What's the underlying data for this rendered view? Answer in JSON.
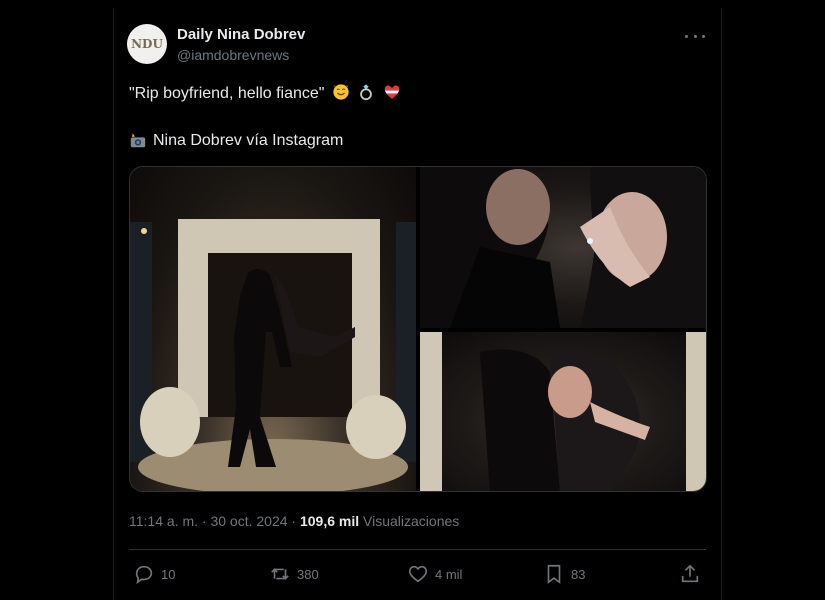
{
  "author": {
    "display_name": "Daily Nina Dobrev",
    "handle": "@iamdobrevnews",
    "avatar_text": "NDU"
  },
  "tweet": {
    "text": "\"Rip boyfriend, hello fiance\"",
    "line2": "Nina Dobrev vía Instagram"
  },
  "media": {
    "photos": [
      "engagement-arch-photo",
      "couple-closeup-ring-photo",
      "couple-kiss-photo"
    ]
  },
  "meta": {
    "time": "11:14 a. m.",
    "date": "30 oct. 2024",
    "views_count": "109,6 mil",
    "views_label": "Visualizaciones"
  },
  "actions": {
    "replies": "10",
    "reposts": "380",
    "likes": "4 mil",
    "bookmarks": "83"
  },
  "colors": {
    "background": "#000000",
    "text": "#e7e9ea",
    "muted": "#71767b",
    "border": "#2f3336"
  }
}
